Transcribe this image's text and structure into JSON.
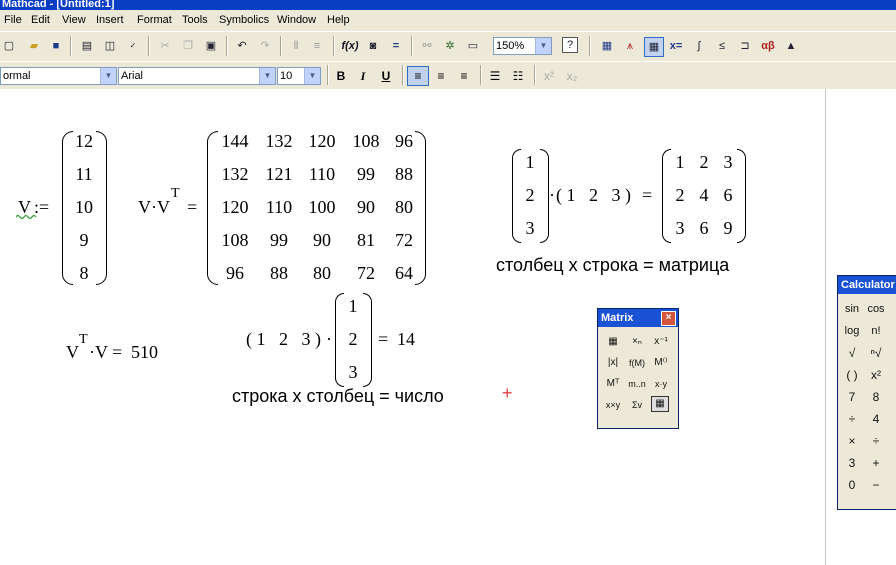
{
  "window": {
    "title": "Mathcad - [Untitled:1]"
  },
  "menu": [
    "File",
    "Edit",
    "View",
    "Insert",
    "Format",
    "Tools",
    "Symbolics",
    "Window",
    "Help"
  ],
  "toolbar": {
    "zoom": "150%"
  },
  "format_bar": {
    "style": "ormal",
    "font": "Arial",
    "size": "10"
  },
  "worksheet": {
    "v_def": {
      "name": "V",
      "assign": ":=",
      "values": [
        "12",
        "11",
        "10",
        "9",
        "8"
      ]
    },
    "outer": {
      "lhs": "V·V",
      "sup": "T",
      "eq": "=",
      "rows": [
        [
          "144",
          "132",
          "120",
          "108",
          "96"
        ],
        [
          "132",
          "121",
          "110",
          "99",
          "88"
        ],
        [
          "120",
          "110",
          "100",
          "90",
          "80"
        ],
        [
          "108",
          "99",
          "90",
          "81",
          "72"
        ],
        [
          "96",
          "88",
          "80",
          "72",
          "64"
        ]
      ]
    },
    "inner": {
      "lhs_base": "V",
      "sup": "T",
      "lhs_rest": "·V",
      "eq": "=",
      "result": "510"
    },
    "col_row": {
      "col": [
        "1",
        "2",
        "3"
      ],
      "dot": "·",
      "row": "( 1   2   3 )",
      "eq": "=",
      "rows": [
        [
          "1",
          "2",
          "3"
        ],
        [
          "2",
          "4",
          "6"
        ],
        [
          "3",
          "6",
          "9"
        ]
      ],
      "caption": "столбец х строка = матрица"
    },
    "row_col": {
      "row": "( 1   2   3 )",
      "dot": "·",
      "col": [
        "1",
        "2",
        "3"
      ],
      "eq": "=",
      "result": "14",
      "caption": "строка х столбец = число"
    }
  },
  "matrix_palette": {
    "title": "Matrix"
  },
  "calculator_palette": {
    "title": "Calculator",
    "buttons": [
      "sin",
      "cos",
      "t",
      "log",
      "n!",
      "√",
      "ⁿ√",
      "( )",
      "x²",
      "7",
      "8",
      "÷",
      "4",
      "×",
      "÷",
      "3",
      "+",
      "0",
      "−"
    ]
  },
  "colors": {
    "titlebar": "#0a3cc4",
    "palette_title": "#1a52d6",
    "chrome": "#ece9d8",
    "cursor": "#e04040"
  }
}
